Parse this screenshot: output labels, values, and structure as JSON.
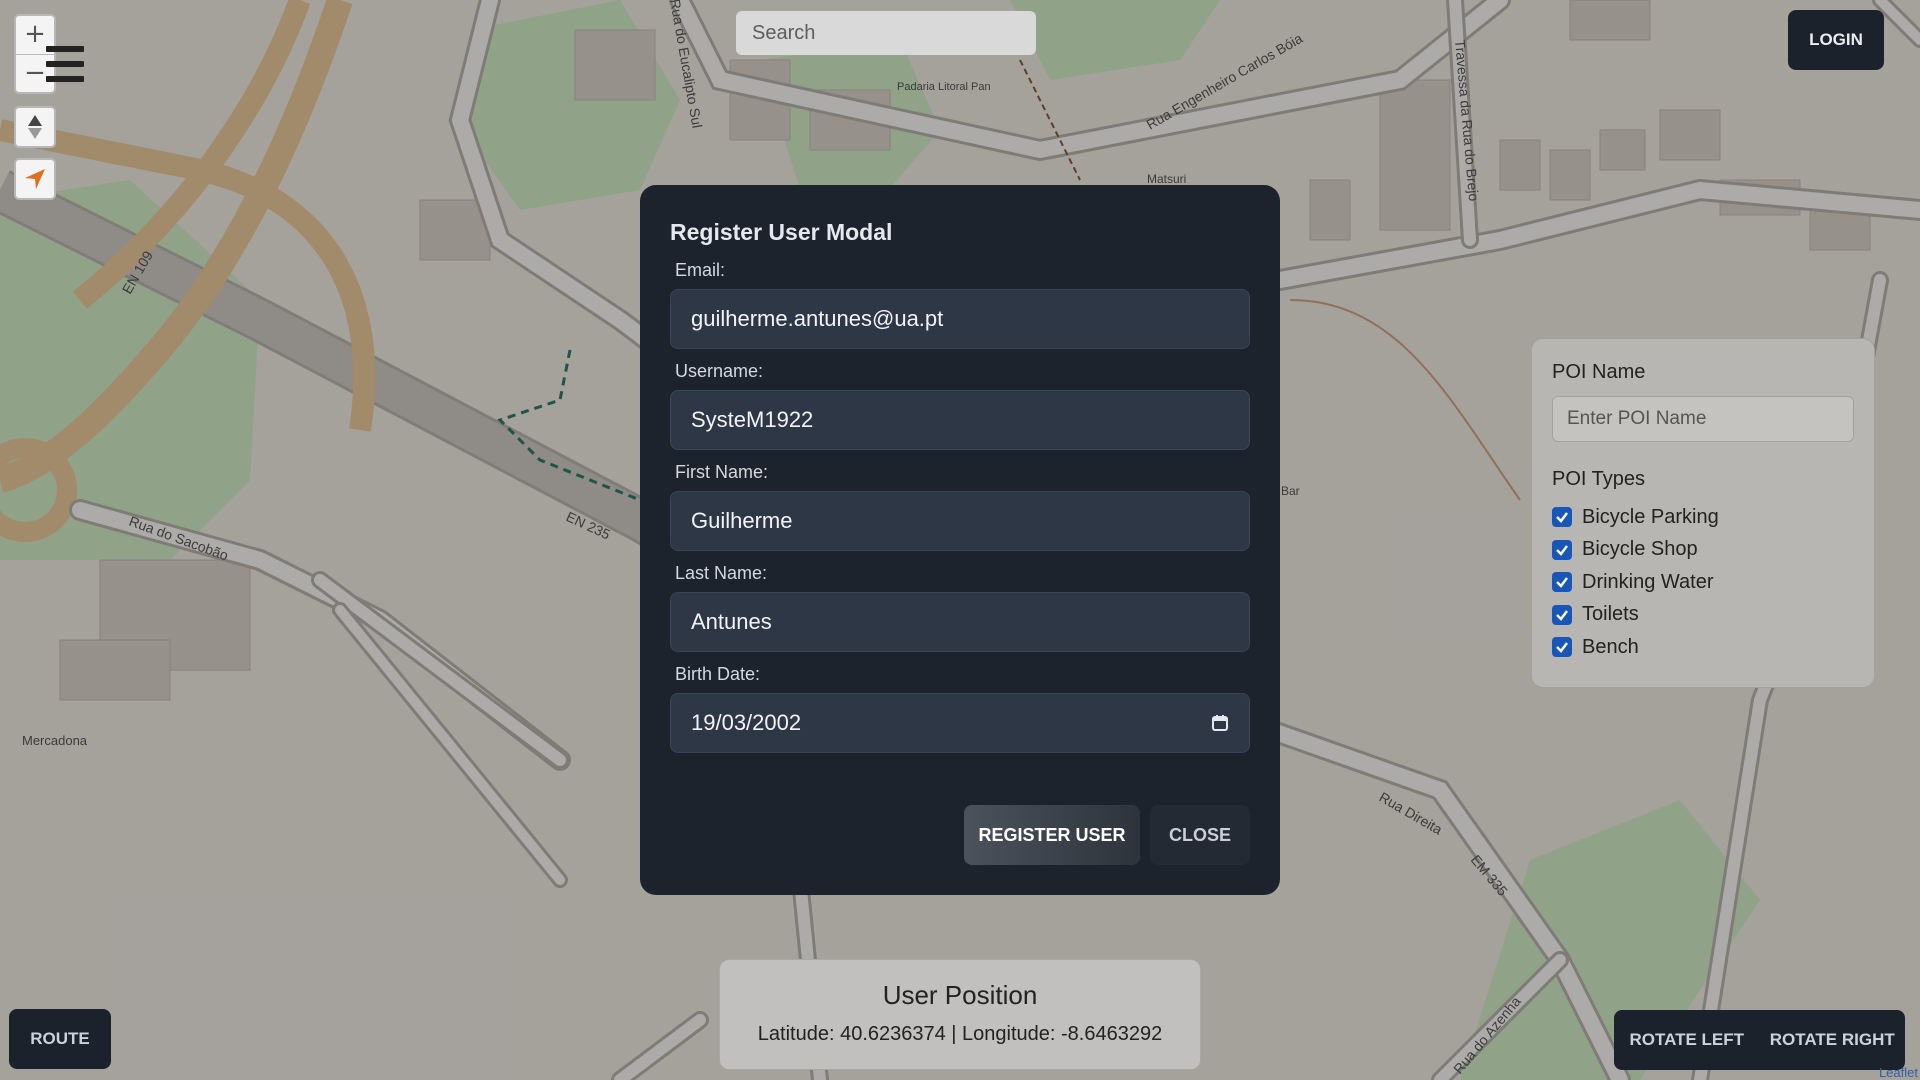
{
  "map": {
    "roads": [
      "Rua Engenheiro Carlos Bóia",
      "Rua do Sacobão",
      "Rua Direita",
      "EN 235",
      "EN 109",
      "EM 335",
      "Travessa da Rua do Brejo",
      "Rua do Eucalipto Sul",
      "Rua do Azenha"
    ],
    "places": [
      "Mercadona",
      "Matsuri",
      "Padaria Litoral Pan",
      "Bar"
    ],
    "attribution": "Leaflet"
  },
  "controls": {
    "zoom_in": "+",
    "zoom_out": "−"
  },
  "search": {
    "placeholder": "Search"
  },
  "login": {
    "label": "LOGIN"
  },
  "poi_panel": {
    "name_label": "POI Name",
    "name_placeholder": "Enter POI Name",
    "types_label": "POI Types",
    "types": [
      {
        "label": "Bicycle Parking",
        "checked": true
      },
      {
        "label": "Bicycle Shop",
        "checked": true
      },
      {
        "label": "Drinking Water",
        "checked": true
      },
      {
        "label": "Toilets",
        "checked": true
      },
      {
        "label": "Bench",
        "checked": true
      }
    ]
  },
  "modal": {
    "title": "Register User Modal",
    "email_label": "Email:",
    "email": "guilherme.antunes@ua.pt",
    "username_label": "Username:",
    "username": "SysteM1922",
    "first_name_label": "First Name:",
    "first_name": "Guilherme",
    "last_name_label": "Last Name:",
    "last_name": "Antunes",
    "birth_label": "Birth Date:",
    "birth_date": "19/03/2002",
    "register_label": "REGISTER USER",
    "close_label": "CLOSE"
  },
  "user_position": {
    "title": "User Position",
    "coords": "Latitude: 40.6236374 | Longitude: -8.6463292"
  },
  "route": {
    "label": "ROUTE"
  },
  "rotate": {
    "left": "ROTATE LEFT",
    "right": "ROTATE RIGHT"
  },
  "colors": {
    "dark": "#1c222c",
    "checkbox": "#1a56b8",
    "modal": "#1d232c"
  }
}
